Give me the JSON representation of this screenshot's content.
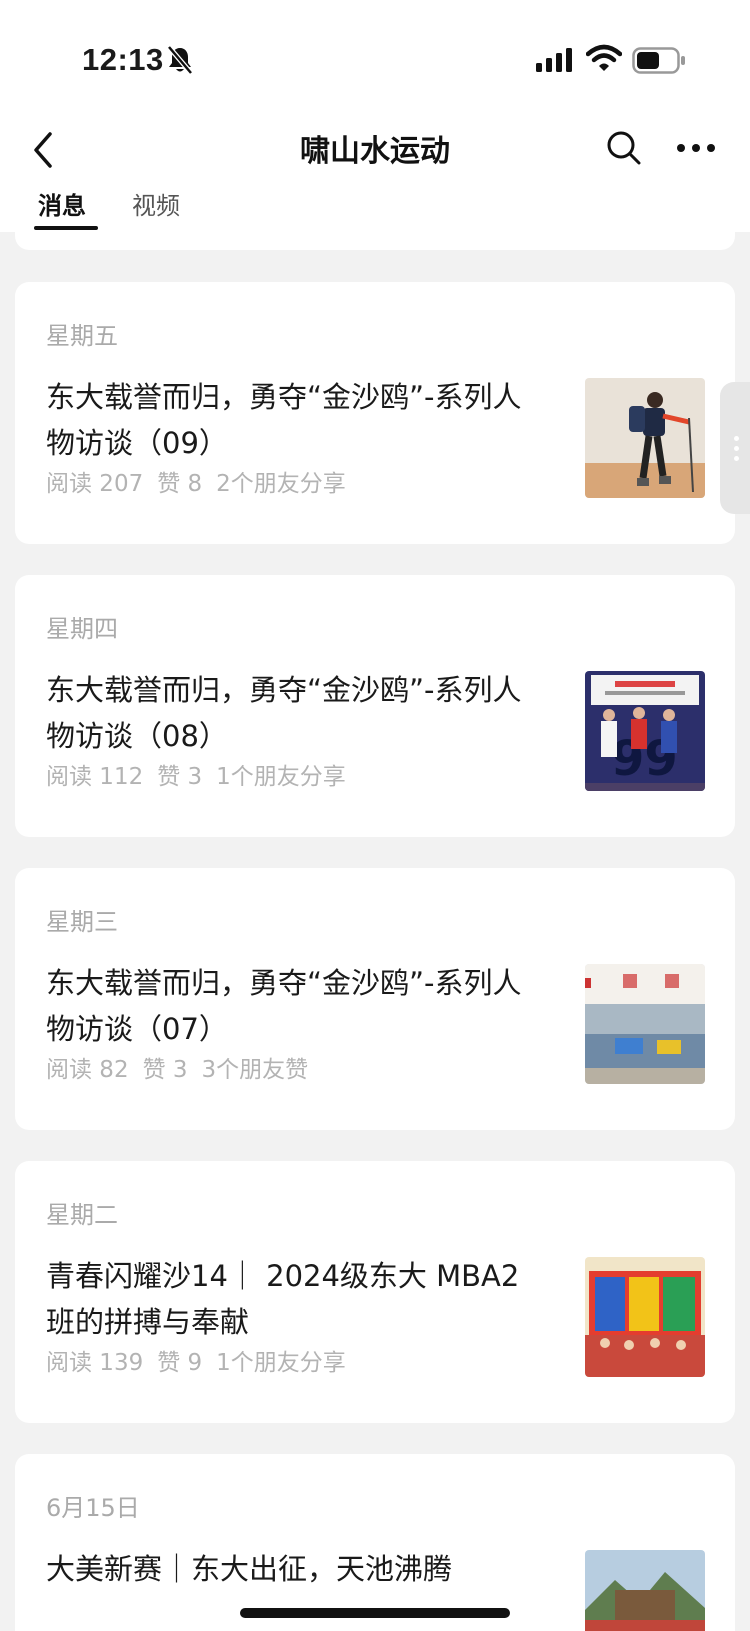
{
  "status_bar": {
    "time": "12:13",
    "icons": [
      "bell-slash-icon",
      "cellular-signal-icon",
      "wifi-icon",
      "battery-icon"
    ]
  },
  "nav": {
    "title": "啸山水运动",
    "back_icon": "chevron-left-icon",
    "search_icon": "search-icon",
    "more_icon": "more-horizontal-icon"
  },
  "tabs": [
    {
      "label": "消息",
      "active": true
    },
    {
      "label": "视频",
      "active": false
    }
  ],
  "articles": [
    {
      "date": "星期五",
      "title": "东大载誉而归，勇夺“金沙鸥”-系列人物访谈（09）",
      "reads": "阅读 207",
      "likes": "赞 8",
      "social": "2个朋友分享"
    },
    {
      "date": "星期四",
      "title": "东大载誉而归，勇夺“金沙鸥”-系列人物访谈（08）",
      "reads": "阅读 112",
      "likes": "赞 3",
      "social": "1个朋友分享"
    },
    {
      "date": "星期三",
      "title": "东大载誉而归，勇夺“金沙鸥”-系列人物访谈（07）",
      "reads": "阅读 82",
      "likes": "赞 3",
      "social": "3个朋友赞"
    },
    {
      "date": "星期二",
      "title": "青春闪耀沙14｜ 2024级东大 MBA2班的拼搏与奉献",
      "reads": "阅读 139",
      "likes": "赞 9",
      "social": "1个朋友分享"
    },
    {
      "date": "6月15日",
      "title": "大美新赛｜东大出征，天池沸腾",
      "reads": "",
      "likes": "",
      "social": ""
    }
  ],
  "colors": {
    "background": "#f2f2f2",
    "card": "#ffffff",
    "muted_text": "#aaaaaa"
  }
}
